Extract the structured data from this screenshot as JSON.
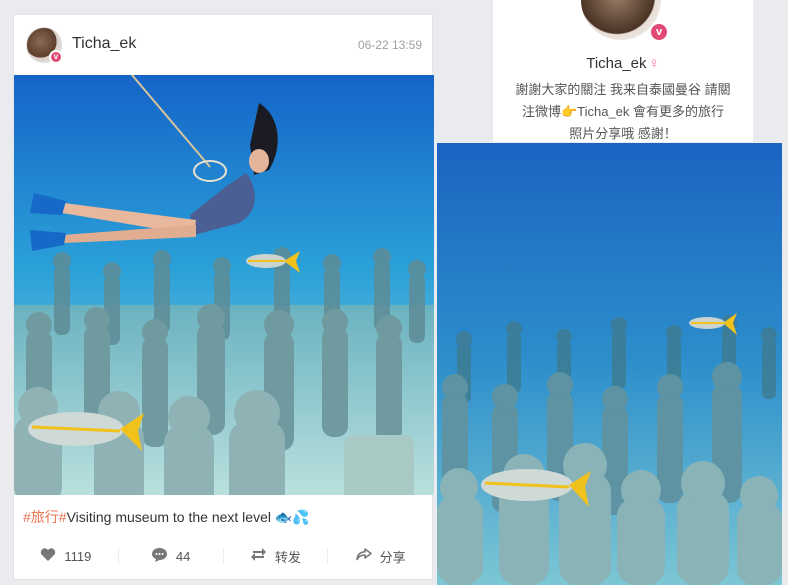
{
  "post": {
    "username": "Ticha_ek",
    "time": "06-22 13:59",
    "verified_badge": "v",
    "caption_tag": "#旅行#",
    "caption_text": "Visiting museum to the next level 🐟💦",
    "like_count": "1119",
    "comment_count": "44",
    "repost_label": "转发",
    "share_label": "分享"
  },
  "profile": {
    "name": "Ticha_ek",
    "gender_symbol": "♀",
    "verified_badge": "v",
    "bio_line1": "謝謝大家的關注 我来自泰國曼谷 請關",
    "bio_line2": "注微博👉Ticha_ek 會有更多的旅行",
    "bio_line3": "照片分享哦 感謝！"
  },
  "icons": {
    "like": "like-icon",
    "comment": "comment-icon",
    "repost": "repost-icon",
    "share": "share-icon"
  },
  "colors": {
    "tag": "#eb7350",
    "badge": "#e04a75",
    "water_top": "#1d6fd0",
    "water_bottom": "#8cd6e2"
  }
}
